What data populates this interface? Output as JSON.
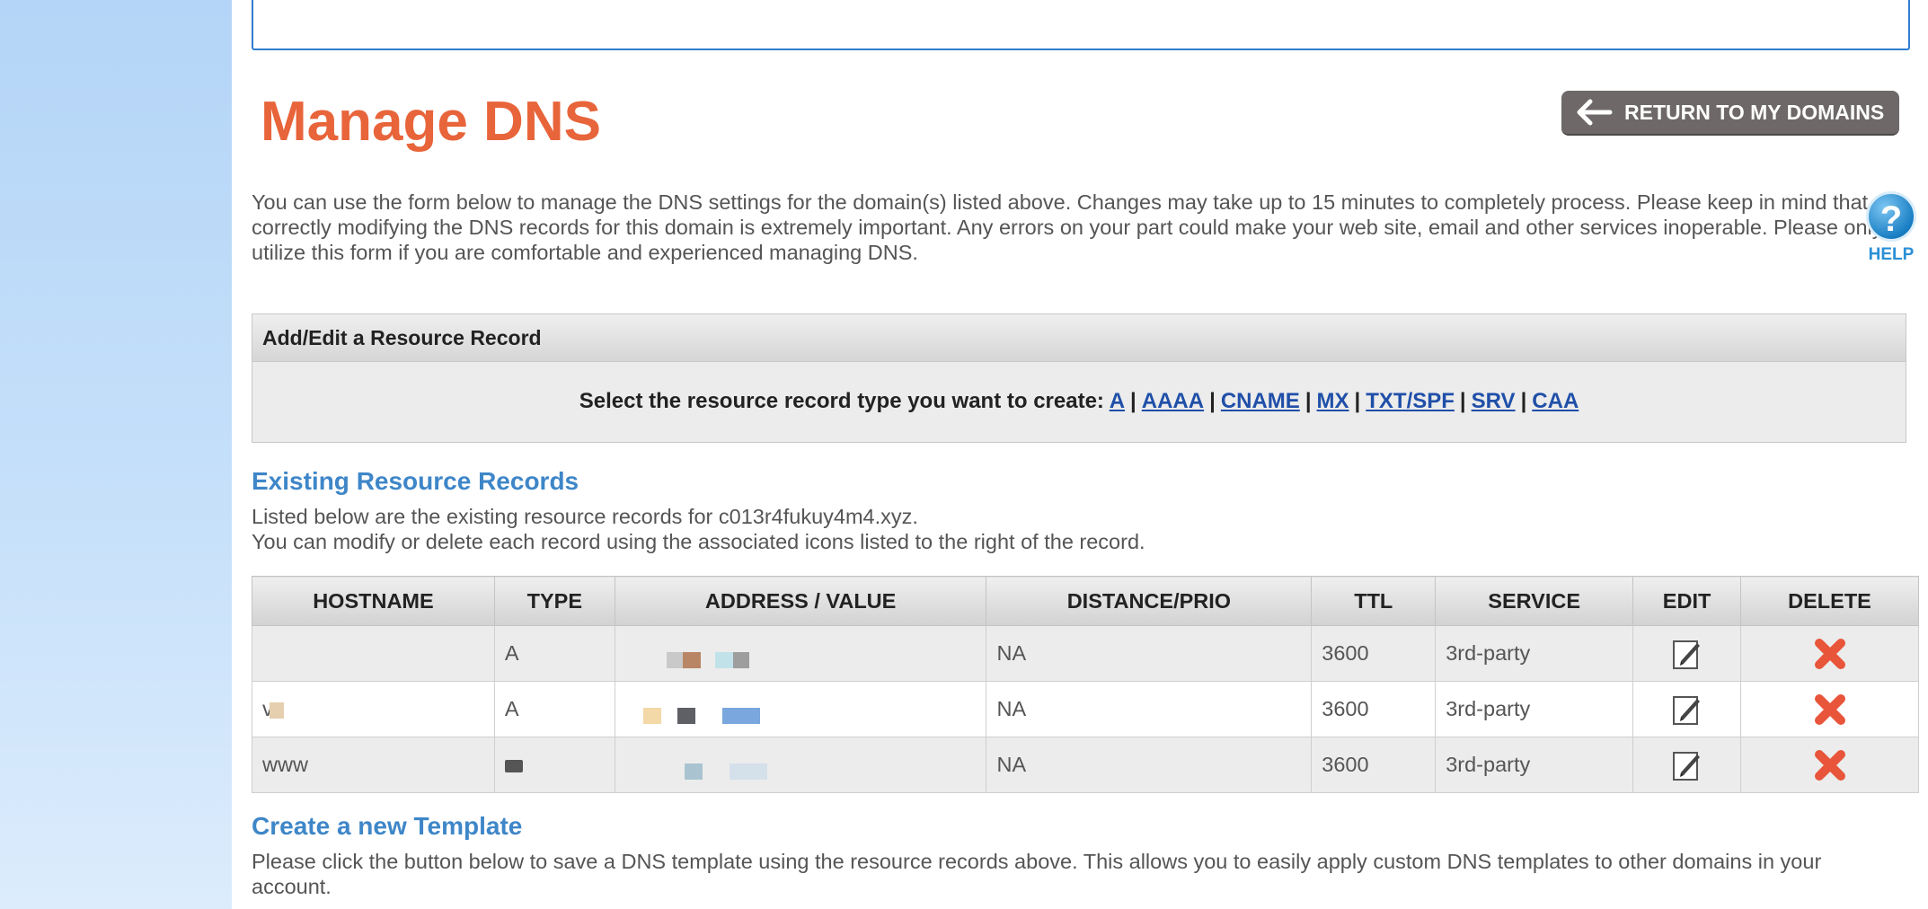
{
  "page": {
    "title": "Manage DNS",
    "return_button": "RETURN TO MY DOMAINS",
    "intro": "You can use the form below to manage the DNS settings for the domain(s) listed above. Changes may take up to 15 minutes to completely process. Please keep in mind that correctly modifying the DNS records for this domain is extremely important. Any errors on your part could make your web site, email and other services inoperable. Please only utilize this form if you are comfortable and experienced managing DNS.",
    "help_label": "HELP",
    "help_glyph": "?"
  },
  "add_panel": {
    "header": "Add/Edit a Resource Record",
    "prompt": "Select the resource record type you want to create:",
    "types": [
      "A",
      "AAAA",
      "CNAME",
      "MX",
      "TXT/SPF",
      "SRV",
      "CAA"
    ]
  },
  "existing": {
    "title": "Existing Resource Records",
    "line1": "Listed below are the existing resource records for c013r4fukuy4m4.xyz.",
    "line2": "You can modify or delete each record using the associated icons listed to the right of the record."
  },
  "table": {
    "headers": [
      "HOSTNAME",
      "TYPE",
      "ADDRESS / VALUE",
      "DISTANCE/PRIO",
      "TTL",
      "SERVICE",
      "EDIT",
      "DELETE"
    ],
    "rows": [
      {
        "hostname": "",
        "type": "A",
        "distance": "NA",
        "ttl": "3600",
        "service": "3rd-party"
      },
      {
        "hostname": "v",
        "type": "A",
        "distance": "NA",
        "ttl": "3600",
        "service": "3rd-party"
      },
      {
        "hostname": "www",
        "type": "",
        "distance": "NA",
        "ttl": "3600",
        "service": "3rd-party"
      }
    ]
  },
  "template": {
    "title": "Create a new Template",
    "desc": "Please click the button below to save a DNS template using the resource records above. This allows you to easily apply custom DNS templates to other domains in your account."
  },
  "icons": {
    "return": "arrow-left-icon",
    "help": "help-icon",
    "edit": "edit-pencil-icon",
    "delete": "delete-x-icon"
  },
  "colors": {
    "title": "#e8643a",
    "section": "#3e86c8",
    "link": "#1f4fa8",
    "delete": "#e8553a",
    "sidebar": "#b4d5f7"
  }
}
